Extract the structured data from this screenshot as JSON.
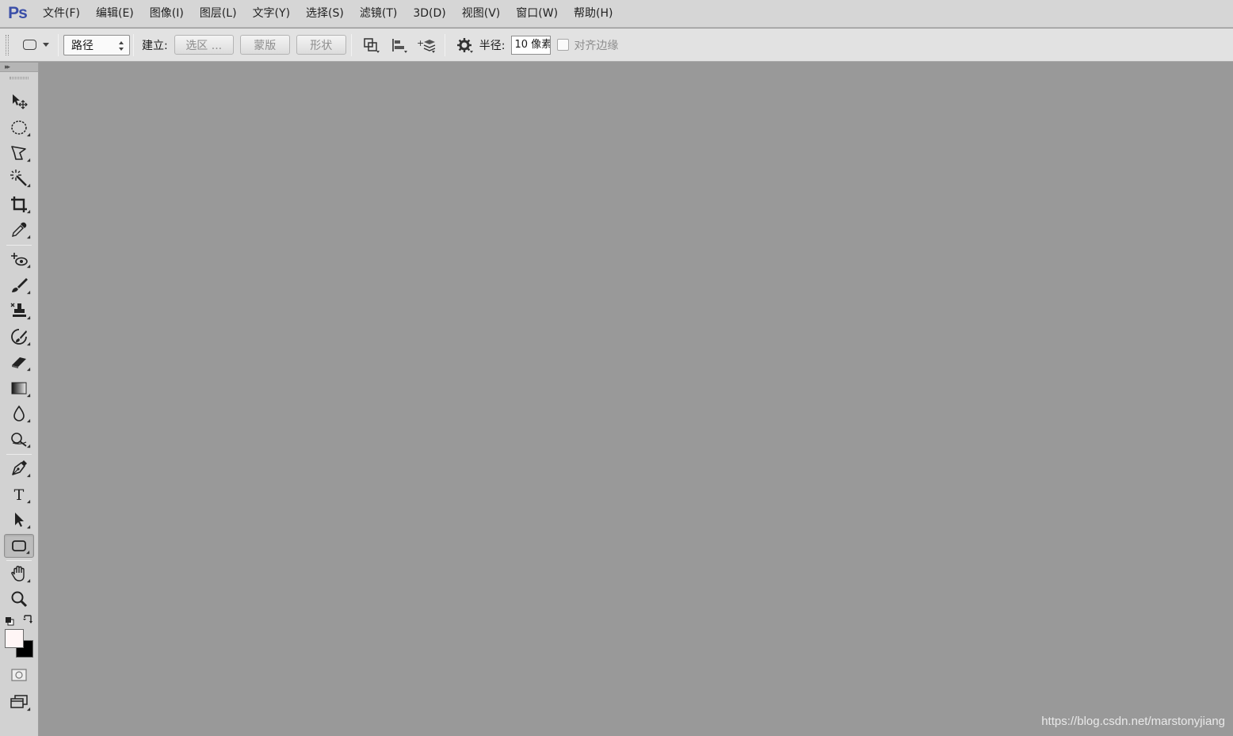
{
  "app": {
    "logo": "Ps"
  },
  "menu": [
    "文件(F)",
    "编辑(E)",
    "图像(I)",
    "图层(L)",
    "文字(Y)",
    "选择(S)",
    "滤镜(T)",
    "3D(D)",
    "视图(V)",
    "窗口(W)",
    "帮助(H)"
  ],
  "options": {
    "mode_select": "路径",
    "make_label": "建立:",
    "btn_selection": "选区 ...",
    "btn_mask": "蒙版",
    "btn_shape": "形状",
    "radius_label": "半径:",
    "radius_value": "10 像素",
    "align_edges_label": "对齐边缘",
    "align_edges_checked": false
  },
  "toolbar": {
    "tools": [
      {
        "name": "move-tool",
        "icon": "move-icon"
      },
      {
        "name": "elliptical-marquee-tool",
        "icon": "ellipse-marquee-icon"
      },
      {
        "name": "lasso-tool",
        "icon": "polygonal-lasso-icon"
      },
      {
        "name": "quick-selection-tool",
        "icon": "magic-wand-icon"
      },
      {
        "name": "crop-tool",
        "icon": "crop-icon"
      },
      {
        "name": "eyedropper-tool",
        "icon": "eyedropper-icon"
      },
      {
        "name": "spot-healing-tool",
        "icon": "healing-brush-icon"
      },
      {
        "name": "brush-tool",
        "icon": "brush-icon"
      },
      {
        "name": "clone-stamp-tool",
        "icon": "stamp-icon"
      },
      {
        "name": "history-brush-tool",
        "icon": "history-brush-icon"
      },
      {
        "name": "eraser-tool",
        "icon": "eraser-icon"
      },
      {
        "name": "gradient-tool",
        "icon": "gradient-icon"
      },
      {
        "name": "blur-tool",
        "icon": "blur-drop-icon"
      },
      {
        "name": "dodge-tool",
        "icon": "dodge-icon"
      },
      {
        "name": "pen-tool",
        "icon": "pen-icon"
      },
      {
        "name": "type-tool",
        "icon": "type-icon"
      },
      {
        "name": "path-selection-tool",
        "icon": "path-selection-arrow-icon"
      },
      {
        "name": "rounded-rectangle-tool",
        "icon": "rounded-rectangle-icon",
        "active": true
      },
      {
        "name": "hand-tool",
        "icon": "hand-icon"
      },
      {
        "name": "zoom-tool",
        "icon": "zoom-icon"
      }
    ],
    "foreground_color": "#fff6f6",
    "background_color": "#000000"
  },
  "canvas": {
    "background": "#999999",
    "watermark": "https://blog.csdn.net/marstonyjiang"
  }
}
